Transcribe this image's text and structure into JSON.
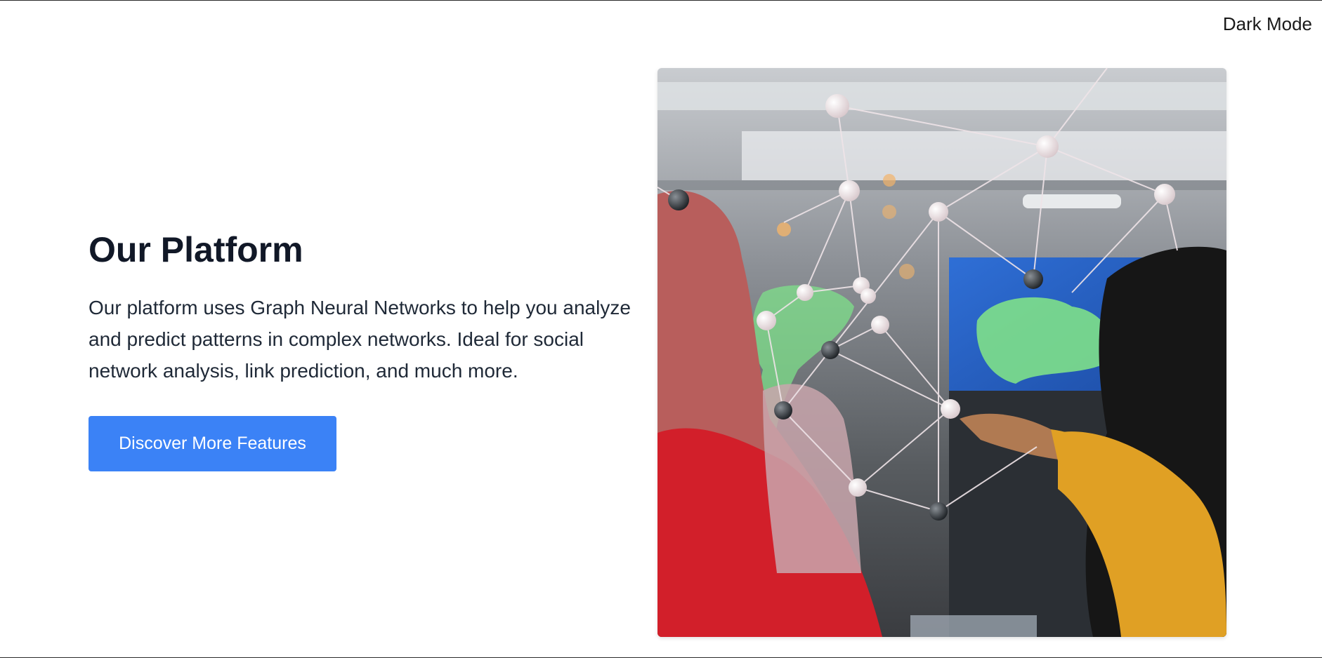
{
  "header": {
    "dark_mode_label": "Dark Mode"
  },
  "hero": {
    "title": "Our Platform",
    "description": "Our platform uses Graph Neural Networks to help you analyze and predict patterns in complex networks. Ideal for social network analysis, link prediction, and much more.",
    "button_label": "Discover More Features"
  },
  "colors": {
    "button_bg": "#3b82f6",
    "title": "#111827",
    "text": "#1f2937"
  }
}
